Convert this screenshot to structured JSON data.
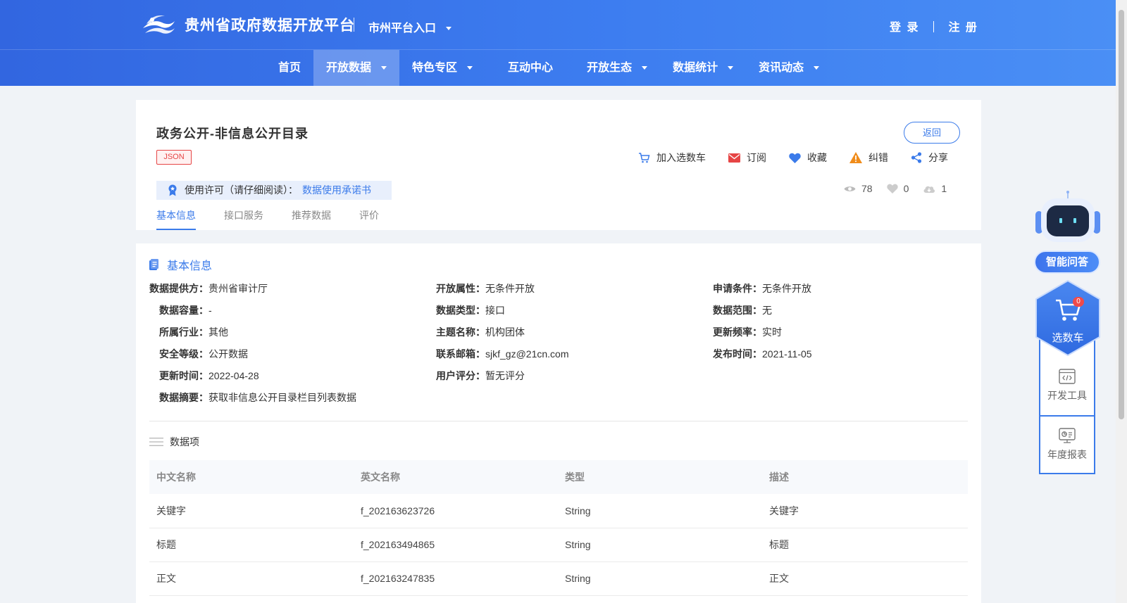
{
  "header": {
    "site_title": "贵州省政府数据开放平台",
    "city_entry": "市州平台入口",
    "login": "登 录",
    "register": "注 册"
  },
  "nav": {
    "items": [
      {
        "label": "首页",
        "has_caret": false
      },
      {
        "label": "开放数据",
        "has_caret": true
      },
      {
        "label": "特色专区",
        "has_caret": true
      },
      {
        "label": "互动中心",
        "has_caret": false
      },
      {
        "label": "开放生态",
        "has_caret": true
      },
      {
        "label": "数据统计",
        "has_caret": true
      },
      {
        "label": "资讯动态",
        "has_caret": true
      }
    ],
    "active": "开放数据"
  },
  "dataset": {
    "title": "政务公开-非信息公开目录",
    "format_tag": "JSON",
    "back_label": "返回",
    "actions": {
      "cart": "加入选数车",
      "subscribe": "订阅",
      "favorite": "收藏",
      "report_error": "纠错",
      "share": "分享"
    },
    "license_label": "使用许可（请仔细阅读）：",
    "license_link": "数据使用承诺书",
    "stats": {
      "views": "78",
      "likes": "0",
      "downloads": "1"
    }
  },
  "tabs": [
    "基本信息",
    "接口服务",
    "推荐数据",
    "评价"
  ],
  "basic_info": {
    "heading": "基本信息",
    "fields": {
      "provider": {
        "label": "数据提供方：",
        "value": "贵州省审计厅"
      },
      "open_attr": {
        "label": "开放属性：",
        "value": "无条件开放"
      },
      "apply_cond": {
        "label": "申请条件：",
        "value": "无条件开放"
      },
      "capacity": {
        "label": "数据容量：",
        "value": "-"
      },
      "data_type": {
        "label": "数据类型：",
        "value": "接口"
      },
      "scope": {
        "label": "数据范围：",
        "value": "无"
      },
      "industry": {
        "label": "所属行业：",
        "value": "其他"
      },
      "topic": {
        "label": "主题名称：",
        "value": "机构团体"
      },
      "frequency": {
        "label": "更新频率：",
        "value": "实时"
      },
      "security": {
        "label": "安全等级：",
        "value": "公开数据"
      },
      "email": {
        "label": "联系邮箱：",
        "value": "sjkf_gz@21cn.com"
      },
      "publish_time": {
        "label": "发布时间：",
        "value": "2021-11-05"
      },
      "update_time": {
        "label": "更新时间：",
        "value": "2022-04-28"
      },
      "rating": {
        "label": "用户评分：",
        "value": "暂无评分"
      },
      "summary": {
        "label": "数据摘要：",
        "value": "获取非信息公开目录栏目列表数据"
      }
    }
  },
  "data_items": {
    "heading": "数据项",
    "columns": [
      "中文名称",
      "英文名称",
      "类型",
      "描述"
    ],
    "rows": [
      [
        "关键字",
        "f_202163623726",
        "String",
        "关键字"
      ],
      [
        "标题",
        "f_202163494865",
        "String",
        "标题"
      ],
      [
        "正文",
        "f_202163247835",
        "String",
        "正文"
      ]
    ]
  },
  "sidebar": {
    "ask_label": "智能问答",
    "cart_label": "选数车",
    "cart_count": "0",
    "dev_tools_label": "开发工具",
    "annual_report_label": "年度报表"
  },
  "colors": {
    "primary": "#3b7bea",
    "header_start": "#3266e0",
    "header_end": "#4a8ff5",
    "tag_red": "#e64545"
  }
}
